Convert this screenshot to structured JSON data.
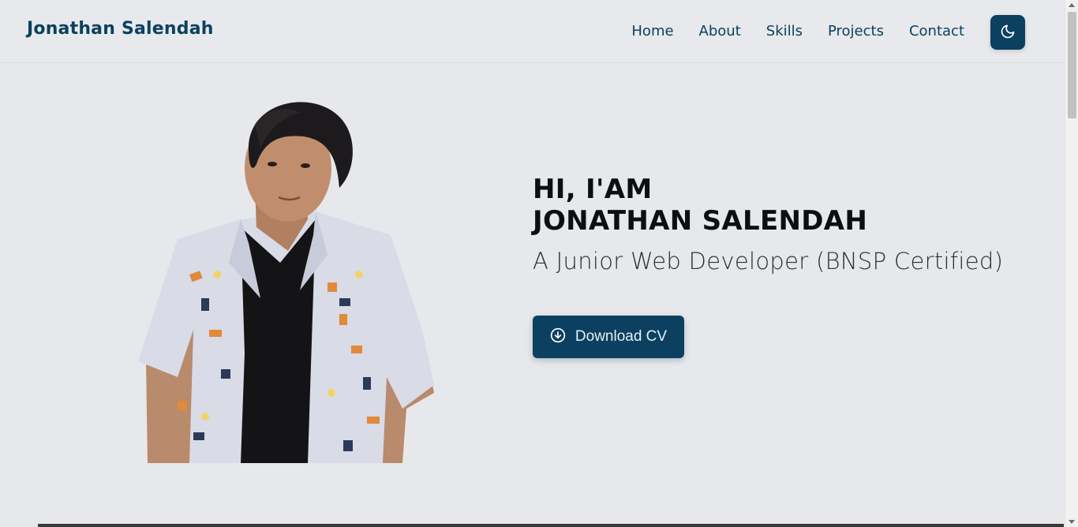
{
  "navbar": {
    "brand": "Jonathan Salendah",
    "links": [
      "Home",
      "About",
      "Skills",
      "Projects",
      "Contact"
    ],
    "theme_toggle_icon": "moon-icon"
  },
  "hero": {
    "greeting": "HI, I'AM",
    "name": "JONATHAN SALENDAH",
    "role": "A Junior Web Developer (BNSP Certified)",
    "cv_button": {
      "label": "Download CV",
      "icon": "download-circle-icon"
    },
    "portrait_icon": "portrait-photo"
  },
  "colors": {
    "background": "#e7e8eb",
    "primary": "#0b4060",
    "text": "#0c0e12"
  }
}
